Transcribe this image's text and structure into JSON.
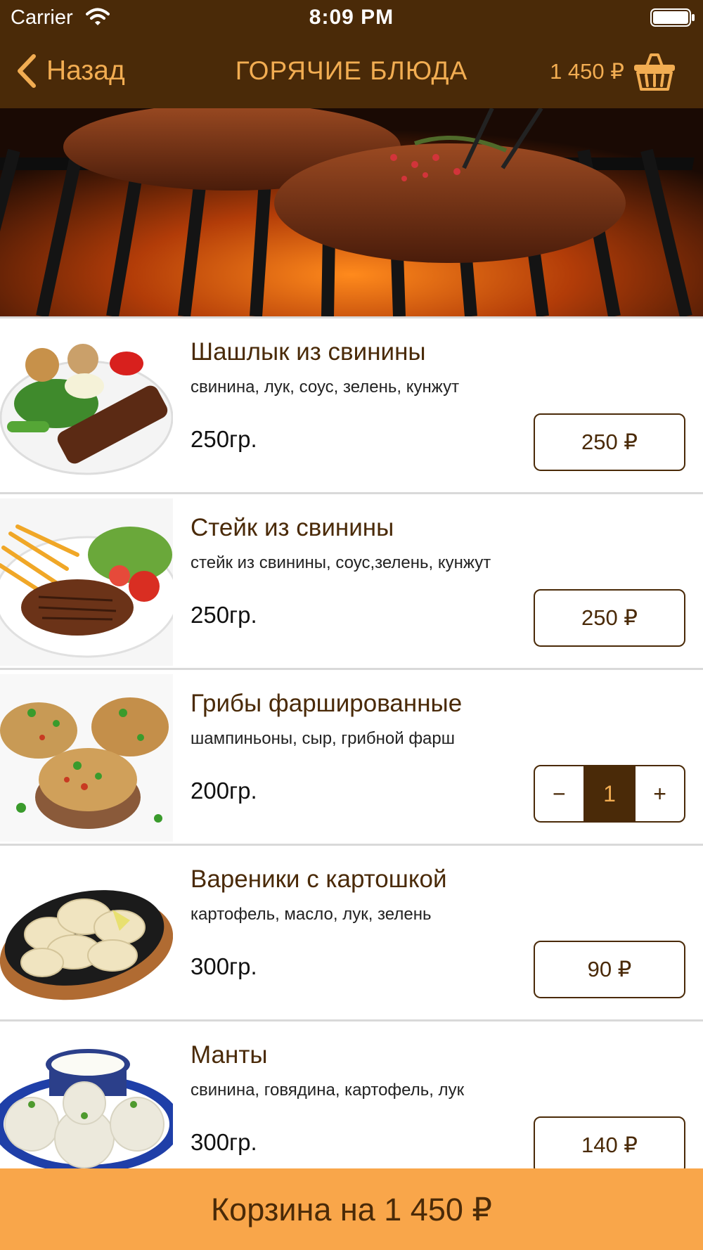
{
  "status_bar": {
    "carrier": "Carrier",
    "time": "8:09 PM"
  },
  "nav": {
    "back_label": "Назад",
    "title": "ГОРЯЧИЕ БЛЮДА",
    "cart_total": "1 450 ₽"
  },
  "colors": {
    "brand_dark": "#4a2a08",
    "accent": "#f2ad52",
    "cart_bar": "#f9a64a"
  },
  "items": [
    {
      "name": "Шашлык из свинины",
      "ingredients": "свинина, лук, соус, зелень, кунжут",
      "weight": "250гр.",
      "price": "250 ₽"
    },
    {
      "name": "Стейк из свинины",
      "ingredients": "стейк из свинины, соус,зелень, кунжут",
      "weight": "250гр.",
      "price": "250 ₽"
    },
    {
      "name": "Грибы фаршированные",
      "ingredients": "шампиньоны, сыр, грибной фарш",
      "weight": "200гр.",
      "quantity": "1",
      "minus": "−",
      "plus": "+"
    },
    {
      "name": "Вареники с картошкой",
      "ingredients": "картофель, масло, лук, зелень",
      "weight": "300гр.",
      "price": "90 ₽"
    },
    {
      "name": "Манты",
      "ingredients": "свинина, говядина, картофель, лук",
      "weight": "300гр.",
      "price": "140 ₽"
    }
  ],
  "cart_bar": {
    "label": "Корзина на 1 450 ₽"
  }
}
